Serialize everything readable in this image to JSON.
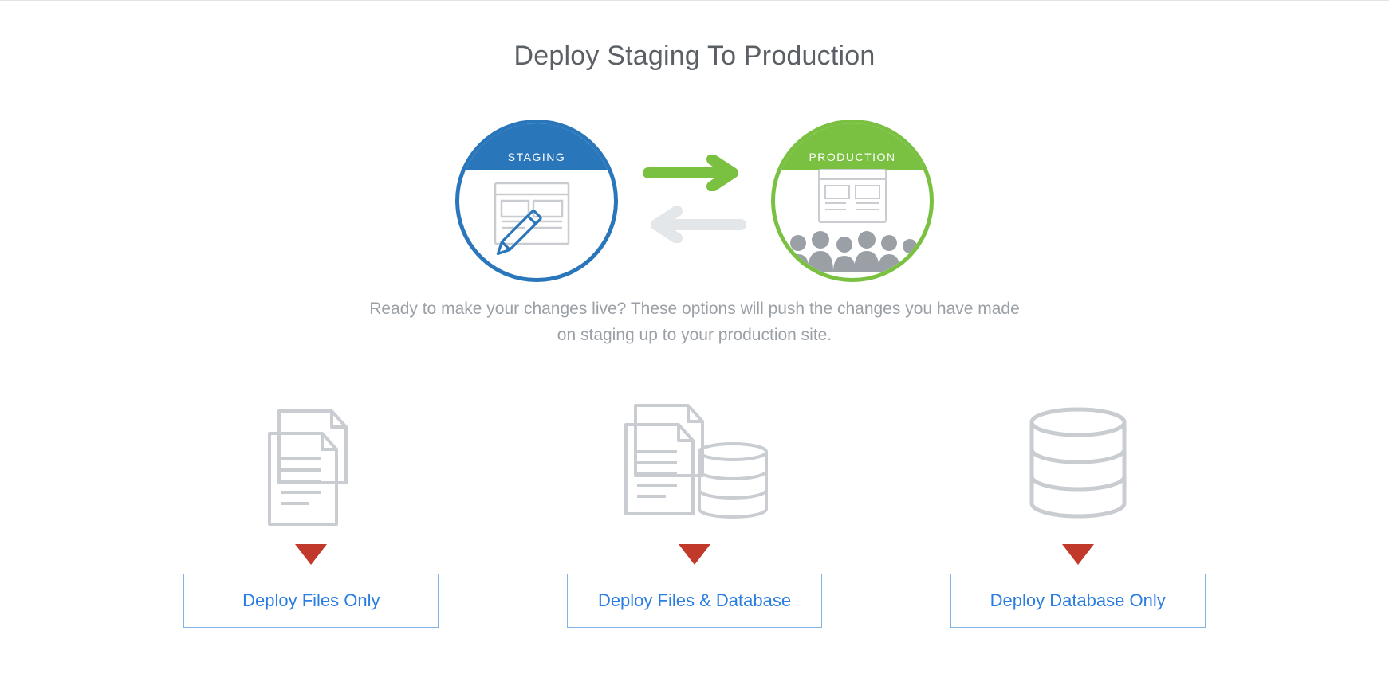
{
  "title": "Deploy Staging To Production",
  "hero": {
    "staging_label": "STAGING",
    "production_label": "PRODUCTION"
  },
  "description": "Ready to make your changes live? These options will push the changes you have made on staging up to your production site.",
  "options": {
    "files": {
      "label": "Deploy Files Only"
    },
    "both": {
      "label": "Deploy Files & Database"
    },
    "db": {
      "label": "Deploy Database Only"
    }
  },
  "colors": {
    "staging": "#2a76bb",
    "production": "#7ac142",
    "arrow_active": "#7ac142",
    "arrow_inactive": "#e4e7ea",
    "icon_outline": "#c9ccd0",
    "pointer": "#c0392b",
    "button_border": "#7fb4e6",
    "button_text": "#2a7de1"
  }
}
